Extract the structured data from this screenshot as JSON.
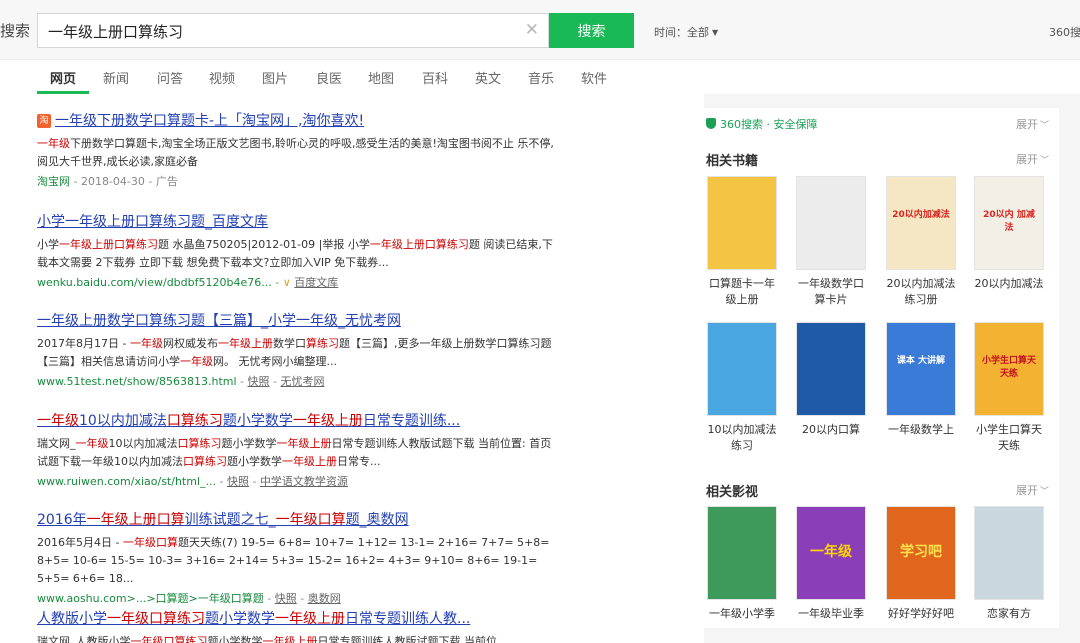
{
  "header": {
    "brand": "搜索",
    "query": "一年级上册口算练习",
    "search_button": "搜索",
    "time_filter": "时间：全部",
    "results_count": "360搜"
  },
  "tabs": [
    "网页",
    "新闻",
    "问答",
    "视频",
    "图片",
    "良医",
    "地图",
    "百科",
    "英文",
    "音乐",
    "软件"
  ],
  "results": [
    {
      "title_parts": [
        [
          "一年级下册数学口算题卡-上「淘宝网」,淘你喜欢!",
          false
        ]
      ],
      "desc_parts": [
        [
          "一年级",
          true
        ],
        [
          "下册数学口算题卡,淘宝全场正版文艺图书,聆听心灵的呼吸,感受生活的美意!淘宝图书阅不止 乐不停,阅见大千世界,成长必读,家庭必备",
          false
        ]
      ],
      "url": "淘宝网",
      "meta": " - 2018-04-30 - 广告",
      "snapshot": "",
      "source": "",
      "badge": "淘"
    },
    {
      "title_parts": [
        [
          "小学一年级上册口算练习题_百度文库",
          false
        ]
      ],
      "desc_parts": [
        [
          "小学",
          false
        ],
        [
          "一年级上册口算练习",
          true
        ],
        [
          "题 水晶鱼750205|2012-01-09 |举报 小学",
          false
        ],
        [
          "一年级上册口算练习",
          true
        ],
        [
          "题 阅读已结束,下载本文需要 2下载券 立即下载 想免费下载本文?立即加入VIP 免下载券...",
          false
        ]
      ],
      "url": "wenku.baidu.com/view/dbdbf5120b4e76...",
      "meta": " - ",
      "snapshot": "",
      "source": "百度文库",
      "badge": ""
    },
    {
      "title_parts": [
        [
          "一年级上册数学口算练习题【三篇】_小学一年级_无忧考网",
          false
        ]
      ],
      "desc_parts": [
        [
          "2017年8月17日 - ",
          false
        ],
        [
          "一年级",
          true
        ],
        [
          "网权威发布",
          false
        ],
        [
          "一年级上册",
          true
        ],
        [
          "数学口",
          false
        ],
        [
          "算练习",
          true
        ],
        [
          "题【三篇】,更多一年级上册数学口算练习题【三篇】相关信息请访问小学",
          false
        ],
        [
          "一年级",
          true
        ],
        [
          "网。 无忧考网小编整理...",
          false
        ]
      ],
      "url": "www.51test.net/show/8563813.html",
      "meta": " - ",
      "snapshot": "快照",
      "source": "无忧考网",
      "badge": ""
    },
    {
      "title_parts": [
        [
          "一年级",
          true
        ],
        [
          "10以内加减法",
          false
        ],
        [
          "口算练习",
          true
        ],
        [
          "题小学数学",
          false
        ],
        [
          "一年级上册",
          true
        ],
        [
          "日常专题训练...",
          false
        ]
      ],
      "desc_parts": [
        [
          "瑞文网_",
          false
        ],
        [
          "一年级",
          true
        ],
        [
          "10以内加减法",
          false
        ],
        [
          "口算练习",
          true
        ],
        [
          "题小学数学",
          false
        ],
        [
          "一年级上册",
          true
        ],
        [
          "日常专题训练人教版试题下载 当前位置: 首页试题下载一年级10以内加减法",
          false
        ],
        [
          "口算练习",
          true
        ],
        [
          "题小学数学",
          false
        ],
        [
          "一年级上册",
          true
        ],
        [
          "日常专...",
          false
        ]
      ],
      "url": "www.ruiwen.com/xiao/st/html_...",
      "meta": " - ",
      "snapshot": "快照",
      "source": "中学语文教学资源",
      "badge": ""
    },
    {
      "title_parts": [
        [
          "2016年",
          false
        ],
        [
          "一年级上册口算",
          true
        ],
        [
          "训练试题之七_",
          false
        ],
        [
          "一年级口算",
          true
        ],
        [
          "题_奥数网",
          false
        ]
      ],
      "desc_parts": [
        [
          "2016年5月4日 - ",
          false
        ],
        [
          "一年级口算",
          true
        ],
        [
          "题天天练(7) 19-5= 6+8= 10+7= 1+12= 13-1= 2+16= 7+7= 5+8= 8+5= 10-6= 15-5= 10-3= 3+16= 2+14= 5+3= 15-2= 16+2= 4+3= 9+10= 8+6= 19-1= 5+5= 6+6= 18...",
          false
        ]
      ],
      "url": "www.aoshu.com>...>口算题>一年级口算题",
      "meta": " - ",
      "snapshot": "快照",
      "source": "奥数网",
      "badge": ""
    },
    {
      "title_parts": [
        [
          "人教版小学",
          false
        ],
        [
          "一年级口算练习",
          true
        ],
        [
          "题小学数学",
          false
        ],
        [
          "一年级上册",
          true
        ],
        [
          "日常专题训练人教...",
          false
        ]
      ],
      "desc_parts": [
        [
          "瑞文网_人教版小学",
          false
        ],
        [
          "一年级口算练习",
          true
        ],
        [
          "题小学数学",
          false
        ],
        [
          "一年级上册",
          true
        ],
        [
          "日常专题训练人教版试题下载 当前位",
          false
        ]
      ],
      "url": "",
      "meta": "",
      "snapshot": "",
      "source": "",
      "badge": ""
    }
  ],
  "sidebar": {
    "safe_label": "360搜索 · 安全保障",
    "expand_label": "展开",
    "books_title": "相关书籍",
    "books": [
      {
        "label": "口算题卡一年级上册",
        "color": "#f4c542"
      },
      {
        "label": "一年级数学口算卡片",
        "color": "#ececec"
      },
      {
        "label": "20以内加减法练习册",
        "color": "#f6e7c4",
        "tag": "20以内加减法",
        "tagcolor": "#d8261f"
      },
      {
        "label": "20以内加减法",
        "color": "#f2efe6",
        "tag": "20以内 加减法",
        "tagcolor": "#d8261f"
      },
      {
        "label": "10以内加减法练习",
        "color": "#4aa6e0"
      },
      {
        "label": "20以内口算",
        "color": "#1f5aa8"
      },
      {
        "label": "一年级数学上",
        "color": "#3b7bd8",
        "tag": "课本 大讲解",
        "tagcolor": "#fff"
      },
      {
        "label": "小学生口算天天练",
        "color": "#f4b233",
        "tag": "小学生口算天天练",
        "tagcolor": "#c4121f"
      }
    ],
    "videos_title": "相关影视",
    "videos": [
      {
        "label": "一年级小学季",
        "color": "#3d9a5a"
      },
      {
        "label": "一年级毕业季",
        "color": "#8a3fb8",
        "tag": "一年级",
        "tagcolor": "#ffd400"
      },
      {
        "label": "好好学好好吧",
        "color": "#e0661e",
        "tag": "学习吧",
        "tagcolor": "#ffe14d"
      },
      {
        "label": "恋家有方",
        "color": "#c9d7df"
      }
    ]
  }
}
